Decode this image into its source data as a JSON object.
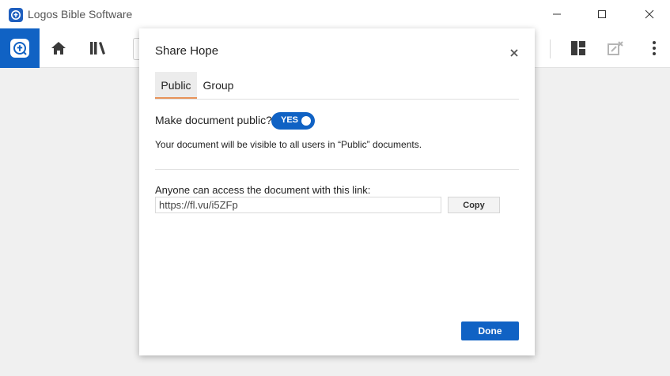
{
  "window": {
    "title": "Logos Bible Software",
    "icons": [
      "logos-app-icon",
      "minimize-icon",
      "maximize-icon",
      "close-icon"
    ]
  },
  "toolbar": {
    "icons": [
      "logos-home-tile-icon",
      "home-icon",
      "library-icon",
      "layouts-icon",
      "undock-panel-icon",
      "more-options-icon"
    ],
    "accent": "#1062c4"
  },
  "dialog": {
    "title": "Share Hope",
    "tabs": [
      {
        "label": "Public",
        "selected": true
      },
      {
        "label": "Group",
        "selected": false
      }
    ],
    "public": {
      "question": "Make document public?",
      "toggle_label": "YES",
      "toggle_on": true,
      "visibility_note": "Your document will be visible to all users in “Public” documents."
    },
    "link": {
      "label": "Anyone can access the document with this link:",
      "value": "https://fl.vu/i5ZFp",
      "copy_label": "Copy"
    },
    "done_label": "Done"
  }
}
